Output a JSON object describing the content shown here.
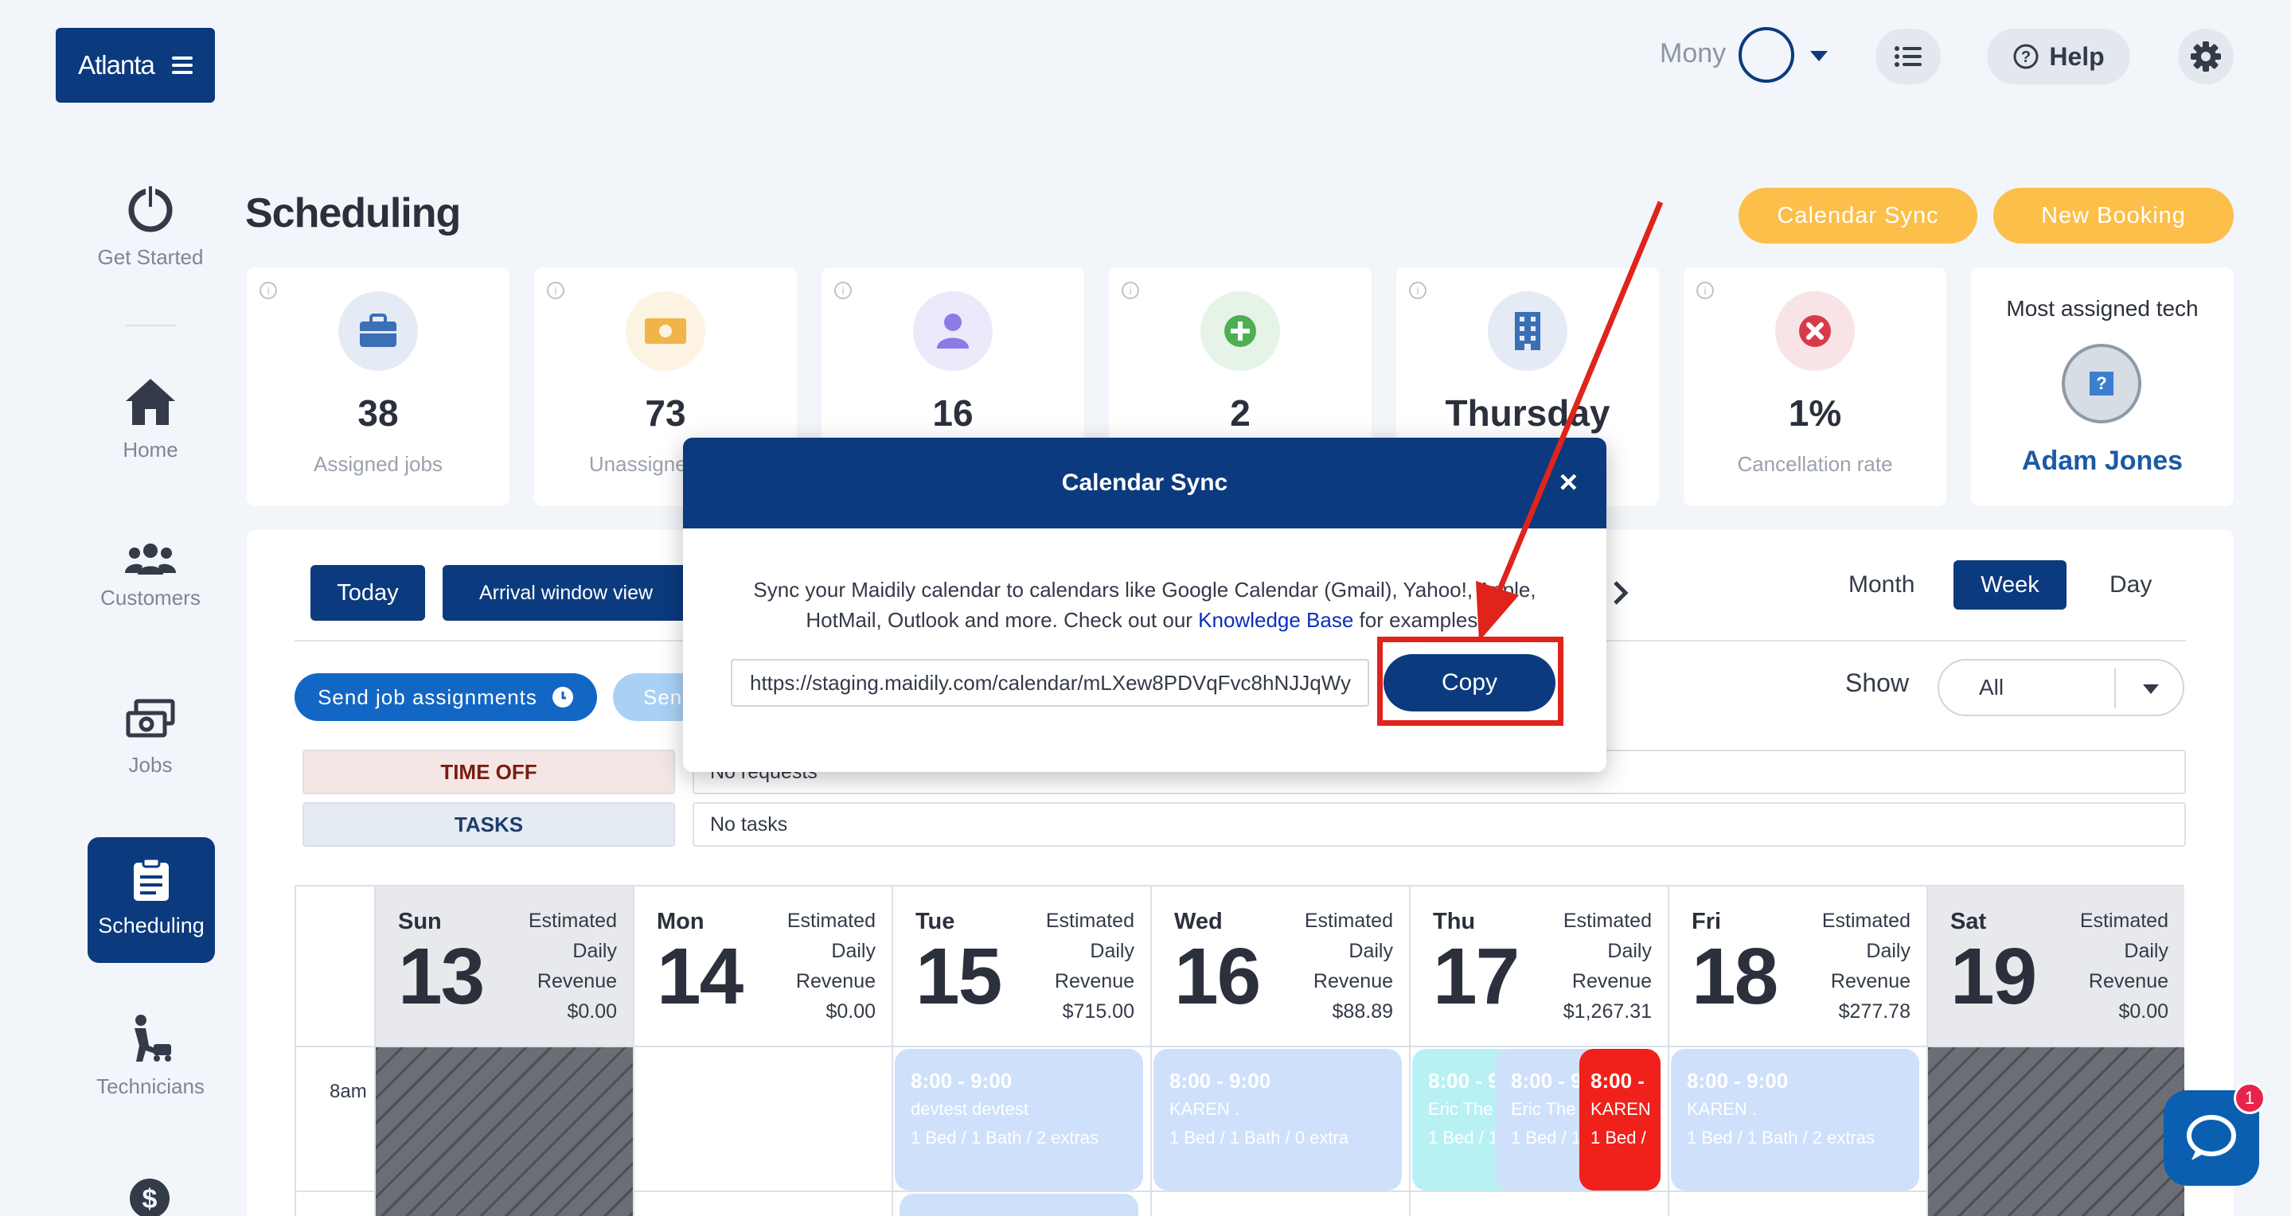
{
  "brand": {
    "label": "Atlanta"
  },
  "header": {
    "user_name": "Mony",
    "help_label": "Help"
  },
  "sidebar": {
    "items": [
      {
        "label": "Get Started",
        "icon": "power-icon"
      },
      {
        "label": "Home",
        "icon": "home-icon"
      },
      {
        "label": "Customers",
        "icon": "users-icon"
      },
      {
        "label": "Jobs",
        "icon": "money-icon"
      },
      {
        "label": "Scheduling",
        "icon": "clipboard-icon",
        "active": true
      },
      {
        "label": "Technicians",
        "icon": "technician-icon"
      }
    ]
  },
  "page": {
    "title": "Scheduling",
    "calendar_sync_label": "Calendar Sync",
    "new_booking_label": "New Booking"
  },
  "stats": [
    {
      "value": "38",
      "label": "Assigned jobs",
      "icon": "briefcase-icon",
      "color": "#3b6fb6"
    },
    {
      "value": "73",
      "label": "Unassigned jobs",
      "icon": "cash-icon",
      "color": "#f0b44a"
    },
    {
      "value": "16",
      "label": "",
      "icon": "person-icon",
      "color": "#8c7be6"
    },
    {
      "value": "2",
      "label": "",
      "icon": "plus-icon",
      "color": "#4caf50"
    },
    {
      "value": "Thursday",
      "label": "",
      "icon": "building-icon",
      "color": "#3b6fb6"
    },
    {
      "value": "1%",
      "label": "Cancellation rate",
      "icon": "x-circle-icon",
      "color": "#d83a4a"
    }
  ],
  "most_assigned": {
    "label": "Most assigned tech",
    "name": "Adam Jones"
  },
  "toolbar": {
    "today_label": "Today",
    "arrival_label": "Arrival window view",
    "send_assignments_label": "Send job assignments",
    "send2_label": "Sen",
    "month_label": "Month",
    "week_label": "Week",
    "day_label": "Day",
    "show_label": "Show",
    "show_value": "All"
  },
  "rows": {
    "time_off_label": "TIME OFF",
    "time_off_value": "No requests",
    "tasks_label": "TASKS",
    "tasks_value": "No tasks"
  },
  "days": [
    {
      "name": "Sun",
      "num": "13",
      "rev_label": "Estimated Daily Revenue",
      "rev": "$0.00"
    },
    {
      "name": "Mon",
      "num": "14",
      "rev_label": "Estimated Daily Revenue",
      "rev": "$0.00"
    },
    {
      "name": "Tue",
      "num": "15",
      "rev_label": "Estimated Daily Revenue",
      "rev": "$715.00"
    },
    {
      "name": "Wed",
      "num": "16",
      "rev_label": "Estimated Daily Revenue",
      "rev": "$88.89"
    },
    {
      "name": "Thu",
      "num": "17",
      "rev_label": "Estimated Daily Revenue",
      "rev": "$1,267.31"
    },
    {
      "name": "Fri",
      "num": "18",
      "rev_label": "Estimated Daily Revenue",
      "rev": "$277.78"
    },
    {
      "name": "Sat",
      "num": "19",
      "rev_label": "Estimated Daily Revenue",
      "rev": "$0.00"
    }
  ],
  "time_label": "8am",
  "jobs": [
    {
      "time": "8:00 - 9:00",
      "name": "devtest devtest",
      "detail": "1 Bed / 1 Bath / 2 extras"
    },
    {
      "time": "8:00 - 9:00",
      "name": "KAREN .",
      "detail": "1 Bed / 1 Bath / 0 extra"
    },
    {
      "time": "8:00 - 9",
      "name": "Eric The /",
      "detail": "1 Bed / 1"
    },
    {
      "time": "8:00 - 9",
      "name": "Eric The /",
      "detail": "1 Bed / 1"
    },
    {
      "time": "8:00 -",
      "name": "KAREN",
      "detail": "1 Bed /"
    },
    {
      "time": "8:00 - 9:00",
      "name": "KAREN .",
      "detail": "1 Bed / 1 Bath / 2 extras"
    }
  ],
  "modal": {
    "title": "Calendar Sync",
    "close": "×",
    "text_before": "Sync your Maidily calendar to calendars like Google Calendar (Gmail), Yahoo!, Apple, HotMail, Outlook and more. Check out our ",
    "link": "Knowledge Base",
    "text_after": " for examples.",
    "url": "https://staging.maidily.com/calendar/mLXew8PDVqFvc8hNJJqWy",
    "copy_label": "Copy"
  },
  "chat": {
    "badge": "1"
  }
}
